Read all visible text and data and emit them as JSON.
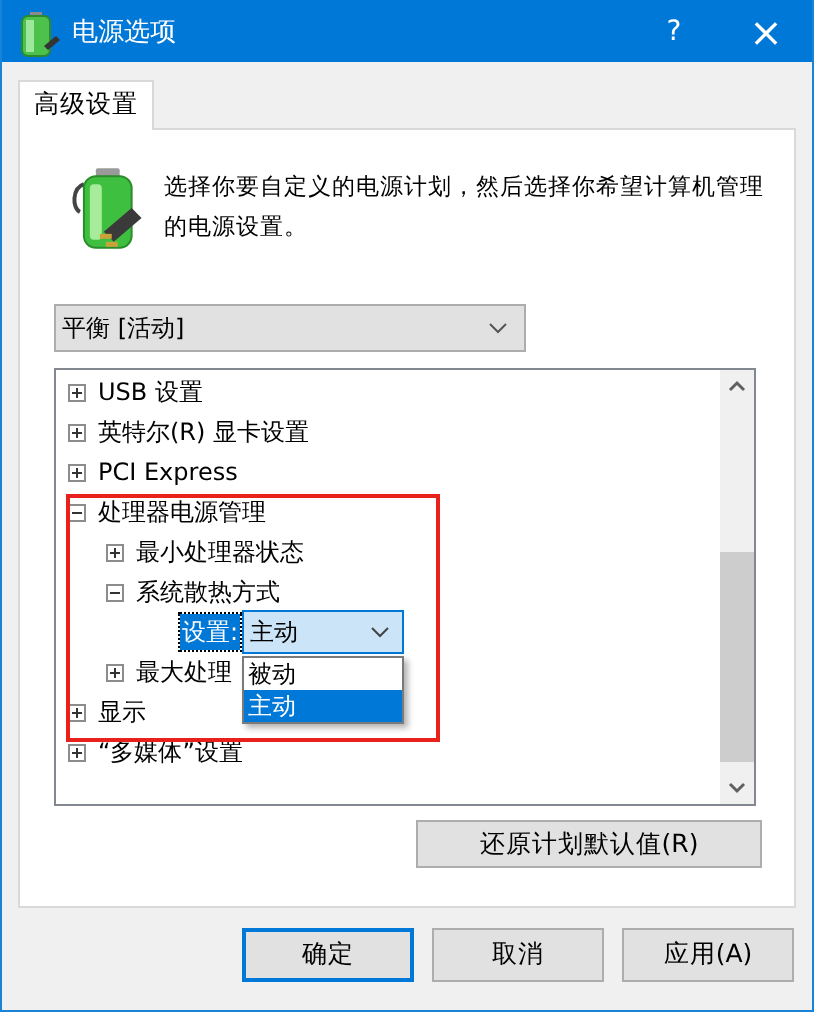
{
  "window": {
    "title": "电源选项",
    "help": "?",
    "close": "×"
  },
  "tabs": [
    {
      "label": "高级设置",
      "selected": true
    }
  ],
  "description": "选择你要自定义的电源计划，然后选择你希望计算机管理的电源设置。",
  "plan_select": {
    "value": "平衡 [活动]"
  },
  "tree": {
    "items": [
      {
        "kind": "group",
        "label": "USB 设置",
        "expanded": false
      },
      {
        "kind": "group",
        "label": "英特尔(R) 显卡设置",
        "expanded": false
      },
      {
        "kind": "group",
        "label": "PCI Express",
        "expanded": false
      },
      {
        "kind": "group",
        "label": "处理器电源管理",
        "expanded": true,
        "children": [
          {
            "kind": "group",
            "label": "最小处理器状态",
            "expanded": false
          },
          {
            "kind": "group",
            "label": "系统散热方式",
            "expanded": true,
            "children": [
              {
                "kind": "setting",
                "label": "设置:",
                "value": "主动",
                "options": [
                  {
                    "label": "被动",
                    "selected": false
                  },
                  {
                    "label": "主动",
                    "selected": true
                  }
                ]
              }
            ]
          },
          {
            "kind": "group",
            "label": "最大处理",
            "expanded": false
          }
        ]
      },
      {
        "kind": "group",
        "label": "显示",
        "expanded": false
      },
      {
        "kind": "group",
        "label": "“多媒体”设置",
        "expanded": false
      }
    ]
  },
  "restore_button": "还原计划默认值(R)",
  "buttons": [
    {
      "label": "确定",
      "default": true
    },
    {
      "label": "取消",
      "default": false
    },
    {
      "label": "应用(A)",
      "default": false
    }
  ]
}
